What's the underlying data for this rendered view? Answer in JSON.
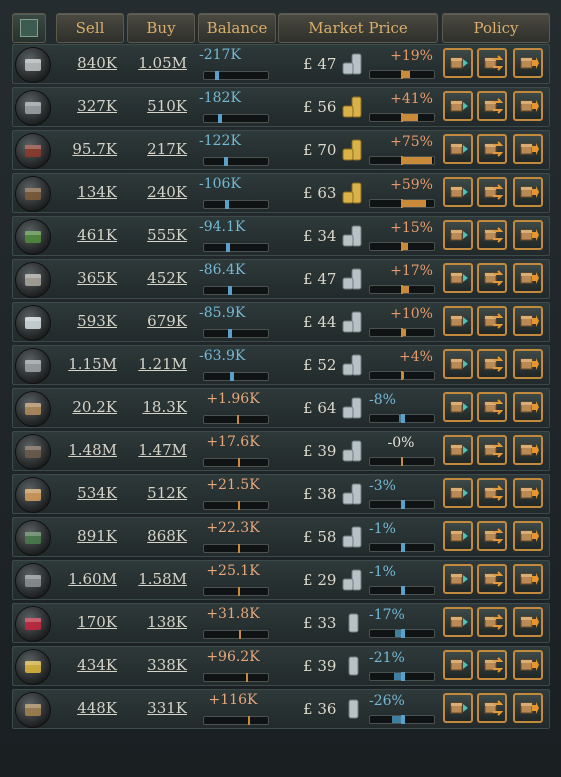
{
  "header": {
    "sell": "Sell",
    "buy": "Buy",
    "balance": "Balance",
    "market_price": "Market Price",
    "policy": "Policy"
  },
  "currency_symbol": "£",
  "goods": [
    {
      "icon": "iron-ingot-icon",
      "sell": "840K",
      "buy": "1.05M",
      "balance": "-217K",
      "price": "47",
      "change": "+19%",
      "change_dir": "up",
      "coin": "silver",
      "balance_level": -0.35,
      "change_level": 0.19
    },
    {
      "icon": "steel-icon",
      "sell": "327K",
      "buy": "510K",
      "balance": "-182K",
      "price": "56",
      "change": "+41%",
      "change_dir": "up",
      "coin": "gold",
      "balance_level": -0.3,
      "change_level": 0.41
    },
    {
      "icon": "wood-icon",
      "sell": "95.7K",
      "buy": "217K",
      "balance": "-122K",
      "price": "70",
      "change": "+75%",
      "change_dir": "up",
      "coin": "gold",
      "balance_level": -0.2,
      "change_level": 0.75
    },
    {
      "icon": "tools-icon",
      "sell": "134K",
      "buy": "240K",
      "balance": "-106K",
      "price": "63",
      "change": "+59%",
      "change_dir": "up",
      "coin": "gold",
      "balance_level": -0.18,
      "change_level": 0.59
    },
    {
      "icon": "fertilizer-icon",
      "sell": "461K",
      "buy": "555K",
      "balance": "-94.1K",
      "price": "34",
      "change": "+15%",
      "change_dir": "up",
      "coin": "silver",
      "balance_level": -0.16,
      "change_level": 0.15
    },
    {
      "icon": "explosives-icon",
      "sell": "365K",
      "buy": "452K",
      "balance": "-86.4K",
      "price": "47",
      "change": "+17%",
      "change_dir": "up",
      "coin": "silver",
      "balance_level": -0.14,
      "change_level": 0.17
    },
    {
      "icon": "glass-icon",
      "sell": "593K",
      "buy": "679K",
      "balance": "-85.9K",
      "price": "44",
      "change": "+10%",
      "change_dir": "up",
      "coin": "silver",
      "balance_level": -0.14,
      "change_level": 0.1
    },
    {
      "icon": "steel-beam-icon",
      "sell": "1.15M",
      "buy": "1.21M",
      "balance": "-63.9K",
      "price": "52",
      "change": "+4%",
      "change_dir": "up",
      "coin": "silver",
      "balance_level": -0.1,
      "change_level": 0.04
    },
    {
      "icon": "ship-icon",
      "sell": "20.2K",
      "buy": "18.3K",
      "balance": "+1.96K",
      "price": "64",
      "change": "-8%",
      "change_dir": "down",
      "coin": "silver",
      "balance_level": 0.01,
      "change_level": -0.08
    },
    {
      "icon": "hammer-icon",
      "sell": "1.48M",
      "buy": "1.47M",
      "balance": "+17.6K",
      "price": "39",
      "change": "-0%",
      "change_dir": "zero",
      "coin": "silver",
      "balance_level": 0.03,
      "change_level": 0
    },
    {
      "icon": "liquor-icon",
      "sell": "534K",
      "buy": "512K",
      "balance": "+21.5K",
      "price": "38",
      "change": "-3%",
      "change_dir": "down",
      "coin": "silver",
      "balance_level": 0.04,
      "change_level": -0.03
    },
    {
      "icon": "locomotive-icon",
      "sell": "891K",
      "buy": "868K",
      "balance": "+22.3K",
      "price": "58",
      "change": "-1%",
      "change_dir": "down",
      "coin": "silver",
      "balance_level": 0.04,
      "change_level": -0.01
    },
    {
      "icon": "ore-icon",
      "sell": "1.60M",
      "buy": "1.58M",
      "balance": "+25.1K",
      "price": "29",
      "change": "-1%",
      "change_dir": "down",
      "coin": "silver",
      "balance_level": 0.04,
      "change_level": -0.01
    },
    {
      "icon": "silk-icon",
      "sell": "170K",
      "buy": "138K",
      "balance": "+31.8K",
      "price": "33",
      "change": "-17%",
      "change_dir": "down",
      "coin": "silver-thin",
      "balance_level": 0.05,
      "change_level": -0.17
    },
    {
      "icon": "grain-icon",
      "sell": "434K",
      "buy": "338K",
      "balance": "+96.2K",
      "price": "39",
      "change": "-21%",
      "change_dir": "down",
      "coin": "silver-thin",
      "balance_level": 0.16,
      "change_level": -0.21
    },
    {
      "icon": "clothes-icon",
      "sell": "448K",
      "buy": "331K",
      "balance": "+116K",
      "price": "36",
      "change": "-26%",
      "change_dir": "down",
      "coin": "silver-thin",
      "balance_level": 0.2,
      "change_level": -0.26
    }
  ]
}
